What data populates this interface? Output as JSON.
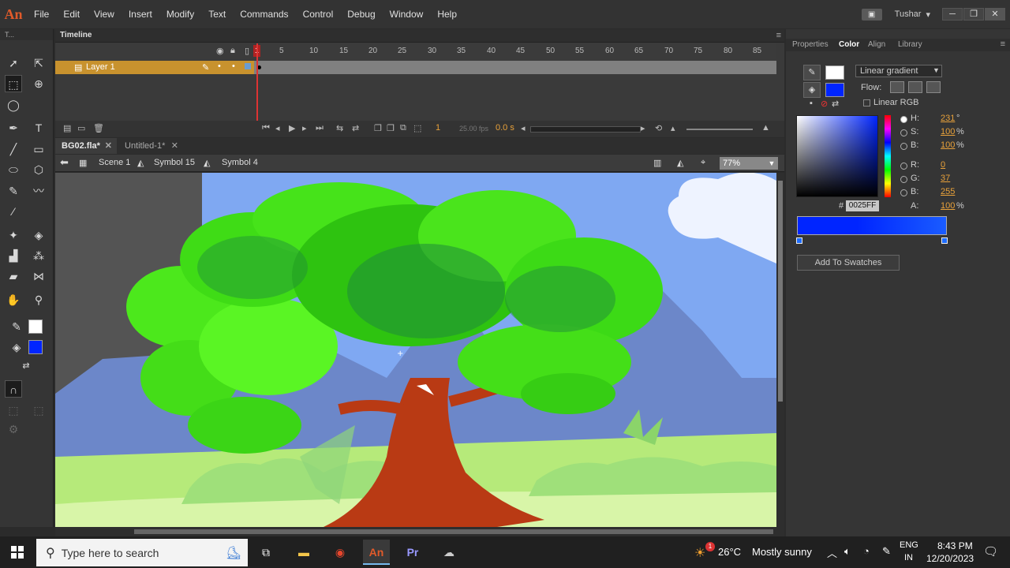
{
  "app": {
    "logo": "An",
    "user": "Tushar",
    "user_caret": "▾"
  },
  "menu": [
    "File",
    "Edit",
    "View",
    "Insert",
    "Modify",
    "Text",
    "Commands",
    "Control",
    "Debug",
    "Window",
    "Help"
  ],
  "window_controls": [
    "─",
    "❐",
    "✕"
  ],
  "toolbar": {
    "header": "T..."
  },
  "timeline": {
    "tab_label": "Timeline",
    "frame_numbers": [
      "1",
      "5",
      "10",
      "15",
      "20",
      "25",
      "30",
      "35",
      "40",
      "45",
      "50",
      "55",
      "60",
      "65",
      "70",
      "75",
      "80",
      "85"
    ],
    "layer_name": "Layer 1",
    "current_frame": "1",
    "fps": "25.00 fps",
    "elapsed": "0.0 s"
  },
  "documents": [
    {
      "name": "BG02.fla*",
      "active": true
    },
    {
      "name": "Untitled-1*",
      "active": false
    }
  ],
  "edit_bar": {
    "crumbs": [
      "Scene 1",
      "Symbol 15",
      "Symbol 4"
    ],
    "zoom": "77%"
  },
  "right_panel": {
    "tabs": [
      "Properties",
      "Color",
      "Align",
      "Library"
    ],
    "active_tab": "Color",
    "gradient_type": "Linear gradient",
    "flow_label": "Flow:",
    "linear_rgb": "Linear RGB",
    "hsb": {
      "h_label": "H:",
      "h": "231",
      "h_unit": "°",
      "s_label": "S:",
      "s": "100",
      "s_unit": "%",
      "b_label": "B:",
      "b": "100",
      "b_unit": "%"
    },
    "rgb": {
      "r_label": "R:",
      "r": "0",
      "g_label": "G:",
      "g": "37",
      "b_label": "B:",
      "b": "255"
    },
    "hex": "0025FF",
    "alpha_label": "A:",
    "alpha": "100",
    "alpha_unit": "%",
    "add_swatches": "Add To Swatches",
    "colors": {
      "fill": "#0025ff",
      "stroke": "#ffffff"
    }
  },
  "taskbar": {
    "search_placeholder": "Type here to search",
    "weather_temp": "26°C",
    "weather_text": "Mostly sunny",
    "weather_badge": "1",
    "lang_top": "ENG",
    "lang_bottom": "IN",
    "time": "8:43 PM",
    "date": "12/20/2023"
  }
}
